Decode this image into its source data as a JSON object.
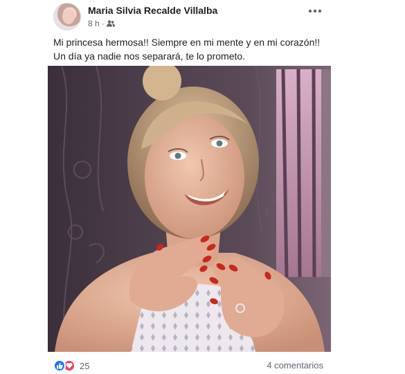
{
  "post": {
    "author": "Maria Silvia Recalde Villalba",
    "time": "8 h",
    "separator": "·",
    "audience_icon": "friends-icon",
    "text": "Mi princesa hermosa!! Siempre en mi mente y en mi corazón!! Un día ya nadie nos separará, te lo prometo.",
    "more_icon": "more-options-icon"
  },
  "footer": {
    "reaction_icons": [
      "like-icon",
      "love-icon"
    ],
    "reaction_count": "25",
    "comments": "4 comentarios"
  },
  "colors": {
    "like": "#1877f2",
    "love": "#f33e58",
    "nails": "#c8281e",
    "text_secondary": "#606770"
  }
}
